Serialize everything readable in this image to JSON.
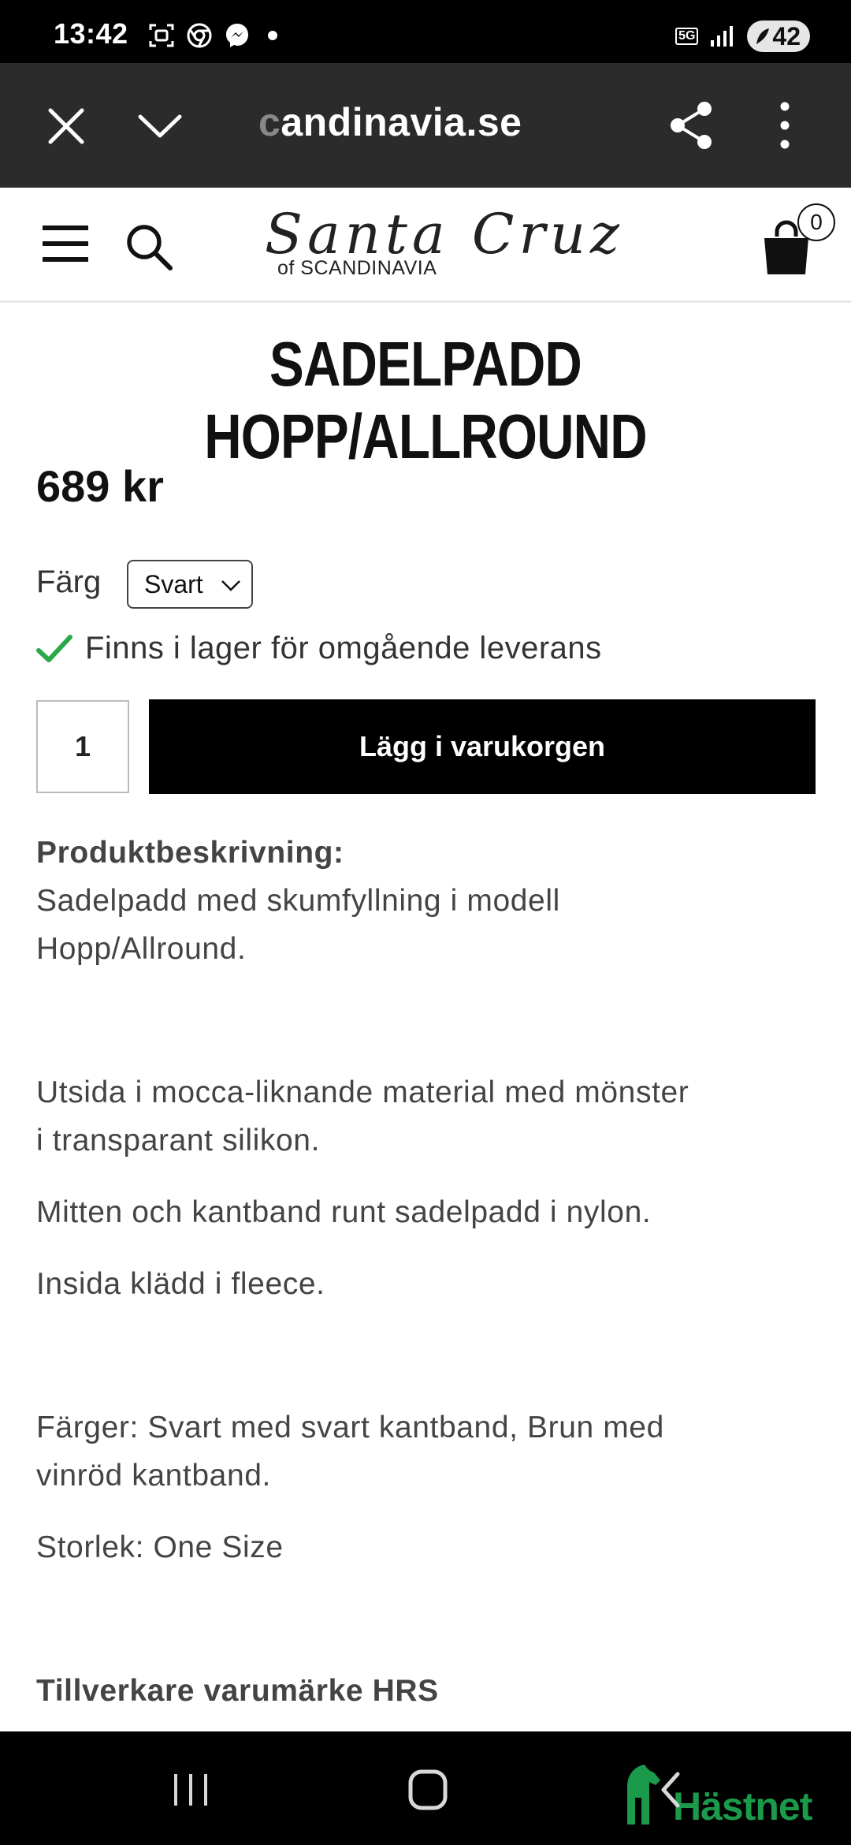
{
  "status_bar": {
    "time": "13:42",
    "network": "5G",
    "battery": "42",
    "icons": [
      "screenshot-icon",
      "chrome-icon",
      "messenger-icon",
      "notification-dot",
      "signal-icon",
      "battery-icon"
    ]
  },
  "browser": {
    "url_fade": "c",
    "url_rest": "andinavia.se",
    "icons": [
      "close-icon",
      "chevron-down-icon",
      "share-icon",
      "more-vert-icon"
    ]
  },
  "header": {
    "logo_script": "Santa Cruz",
    "logo_sub": "of SCANDINAVIA",
    "cart_count": "0",
    "icons": [
      "menu-icon",
      "search-icon",
      "shopping-bag-icon"
    ]
  },
  "product": {
    "title": "SADELPADD HOPP/ALLROUND",
    "price": "689 kr",
    "color_label": "Färg",
    "color_selected": "Svart",
    "stock_text": "Finns i lager för omgående leverans",
    "quantity": "1",
    "add_to_cart": "Lägg i varukorgen",
    "stock_color": "#2aa84a"
  },
  "description": {
    "heading": "Produktbeskrivning:",
    "line1": "Sadelpadd med skumfyllning i modell",
    "line2": "Hopp/Allround.",
    "para2_line1": "Utsida i mocca-liknande material med mönster",
    "para2_line2": "i transparant silikon.",
    "para3": "Mitten och kantband runt sadelpadd i nylon.",
    "para4": "Insida klädd i fleece.",
    "para5_line1": "Färger: Svart med svart kantband, Brun med",
    "para5_line2": "vinröd kantband.",
    "para6": "Storlek: One Size",
    "manufacturer": "Tillverkare varumärke HRS"
  },
  "nav": {
    "watermark": "Hästnet",
    "watermark_color": "#1a9a4a",
    "icons": [
      "recent-apps-icon",
      "home-icon",
      "back-icon"
    ]
  }
}
